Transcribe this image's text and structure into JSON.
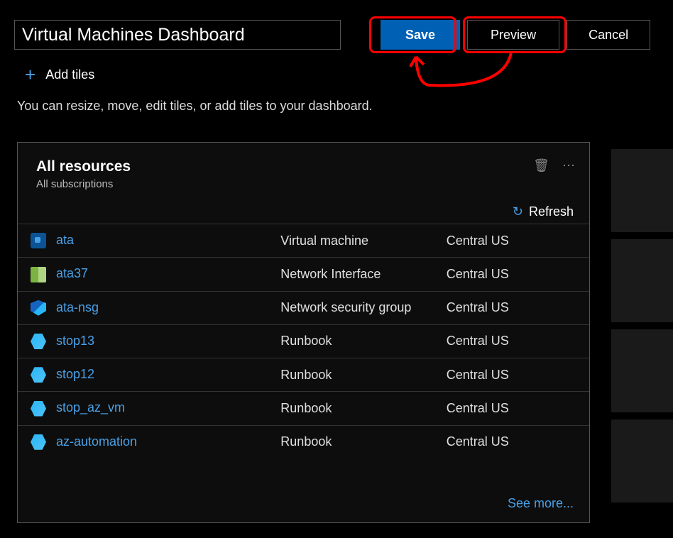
{
  "header": {
    "title_value": "Virtual Machines Dashboard",
    "save_label": "Save",
    "preview_label": "Preview",
    "cancel_label": "Cancel"
  },
  "toolbar": {
    "add_tiles_label": "Add tiles",
    "hint": "You can resize, move, edit tiles, or add tiles to your dashboard."
  },
  "tile": {
    "title": "All resources",
    "subtitle": "All subscriptions",
    "refresh_label": "Refresh",
    "see_more_label": "See more..."
  },
  "resources": [
    {
      "name": "ata",
      "type": "Virtual machine",
      "location": "Central US",
      "icon": "vm"
    },
    {
      "name": "ata37",
      "type": "Network Interface",
      "location": "Central US",
      "icon": "ni"
    },
    {
      "name": "ata-nsg",
      "type": "Network security group",
      "location": "Central US",
      "icon": "nsg"
    },
    {
      "name": "stop13",
      "type": "Runbook",
      "location": "Central US",
      "icon": "rb"
    },
    {
      "name": "stop12",
      "type": "Runbook",
      "location": "Central US",
      "icon": "rb"
    },
    {
      "name": "stop_az_vm",
      "type": "Runbook",
      "location": "Central US",
      "icon": "rb"
    },
    {
      "name": "az-automation",
      "type": "Runbook",
      "location": "Central US",
      "icon": "rb"
    }
  ]
}
